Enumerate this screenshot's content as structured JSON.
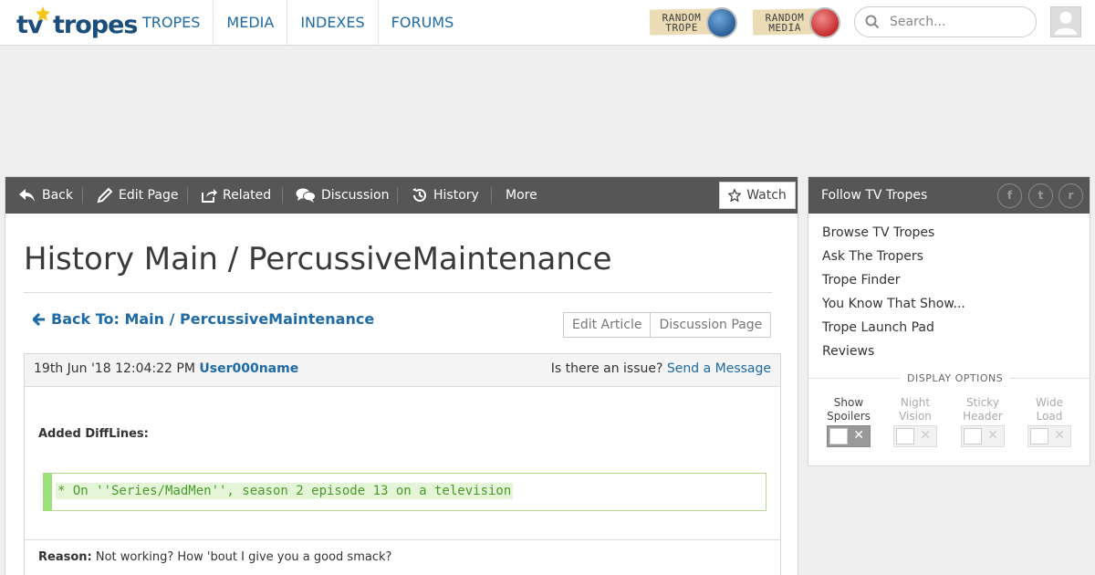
{
  "header": {
    "logo": {
      "left": "tv",
      "right": "tropes"
    },
    "nav": [
      "TROPES",
      "MEDIA",
      "INDEXES",
      "FORUMS"
    ],
    "random_trope": {
      "line1": "RANDOM",
      "line2": "TROPE"
    },
    "random_media": {
      "line1": "RANDOM",
      "line2": "MEDIA"
    },
    "search_placeholder": "Search..."
  },
  "toolbar": {
    "back": "Back",
    "edit_page": "Edit Page",
    "related": "Related",
    "discussion": "Discussion",
    "history": "History",
    "more": "More",
    "watch": "Watch"
  },
  "page": {
    "title": "History Main / PercussiveMaintenance",
    "back_to": "Back To: Main / PercussiveMaintenance",
    "edit_article": "Edit Article",
    "discussion_page": "Discussion Page"
  },
  "edit": {
    "timestamp": "19th Jun '18 12:04:22 PM",
    "user": "User000name",
    "issue_text": "Is there an issue?",
    "send_message": "Send a Message",
    "diff_label": "Added DiffLines:",
    "diff_line": "* On ''Series/MadMen'', season 2 episode 13 on a television",
    "reason_label": "Reason:",
    "reason_text": "Not working? How 'bout I give you a good smack?"
  },
  "sidebar": {
    "follow": "Follow TV Tropes",
    "social": [
      "f",
      "t",
      "r"
    ],
    "links": [
      "Browse TV Tropes",
      "Ask The Tropers",
      "Trope Finder",
      "You Know That Show...",
      "Trope Launch Pad",
      "Reviews"
    ],
    "display_options": "DISPLAY OPTIONS",
    "toggles": [
      {
        "line1": "Show",
        "line2": "Spoilers",
        "active": true
      },
      {
        "line1": "Night",
        "line2": "Vision",
        "active": false
      },
      {
        "line1": "Sticky",
        "line2": "Header",
        "active": false
      },
      {
        "line1": "Wide",
        "line2": "Load",
        "active": false
      }
    ],
    "toggle_x": "✕"
  },
  "colors": {
    "link": "#1e6aa6",
    "toolbar": "#565656",
    "diff_text": "#4a9a2a",
    "diff_bar": "#9be07a"
  }
}
